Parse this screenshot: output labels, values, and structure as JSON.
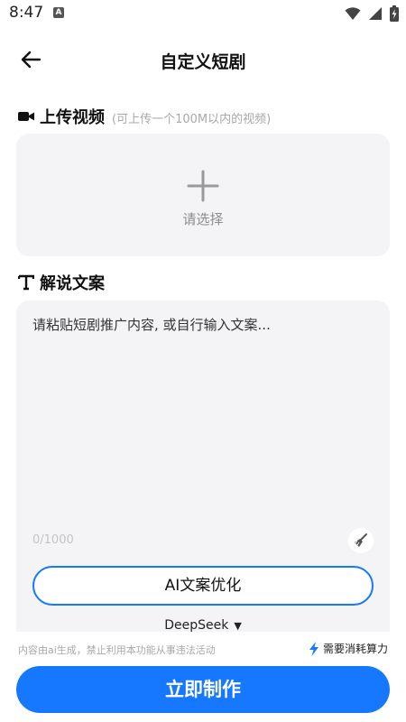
{
  "status_bar": {
    "time": "8:47",
    "notification_letter": "A"
  },
  "header": {
    "title": "自定义短剧"
  },
  "upload_section": {
    "title": "上传视频",
    "hint": "(可上传一个100M以内的视频)",
    "select_label": "请选择"
  },
  "script_section": {
    "title": "解说文案",
    "placeholder": "请粘贴短剧推广内容, 或自行输入文案...",
    "counter": "0/1000",
    "optimize_label": "AI文案优化",
    "model": "DeepSeek"
  },
  "footer": {
    "disclaimer": "内容由ai生成，禁止利用本功能从事违法活动",
    "cost_note": "需要消耗算力",
    "make_label": "立即制作"
  },
  "colors": {
    "accent": "#1677ff",
    "panel": "#f4f4f6"
  },
  "icons": [
    "back-arrow-icon",
    "video-camera-icon",
    "plus-icon",
    "text-t-icon",
    "broom-icon",
    "lightning-icon",
    "wifi-icon",
    "signal-icon",
    "battery-icon",
    "caret-down-icon"
  ]
}
